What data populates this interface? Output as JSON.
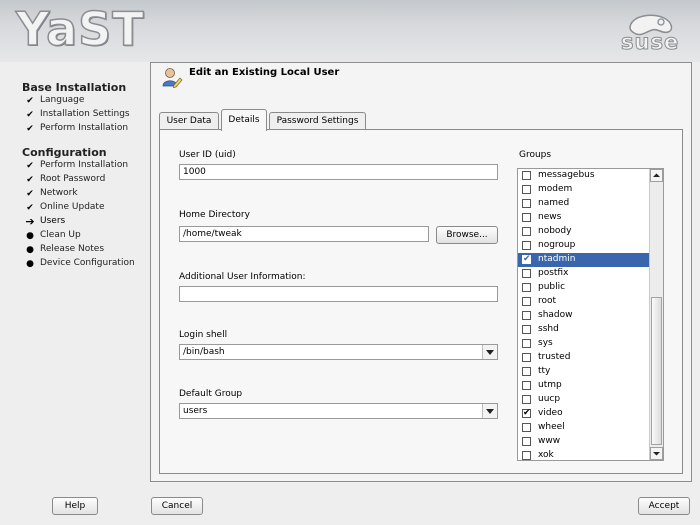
{
  "banner": {
    "app_logo": "YaST",
    "brand_logo": "suse"
  },
  "sidebar": {
    "sections": [
      {
        "title": "Base Installation",
        "steps": [
          {
            "label": "Language",
            "status": "done"
          },
          {
            "label": "Installation Settings",
            "status": "done"
          },
          {
            "label": "Perform Installation",
            "status": "done"
          }
        ]
      },
      {
        "title": "Configuration",
        "steps": [
          {
            "label": "Perform Installation",
            "status": "done"
          },
          {
            "label": "Root Password",
            "status": "done"
          },
          {
            "label": "Network",
            "status": "done"
          },
          {
            "label": "Online Update",
            "status": "done"
          },
          {
            "label": "Users",
            "status": "current"
          },
          {
            "label": "Clean Up",
            "status": "pending"
          },
          {
            "label": "Release Notes",
            "status": "pending"
          },
          {
            "label": "Device Configuration",
            "status": "pending"
          }
        ]
      }
    ]
  },
  "dialog": {
    "title": "Edit an Existing Local User",
    "tabs": [
      {
        "label": "User Data",
        "active": false
      },
      {
        "label": "Details",
        "active": true
      },
      {
        "label": "Password Settings",
        "active": false
      }
    ]
  },
  "details": {
    "uid_label": "User ID (uid)",
    "uid_value": "1000",
    "home_label": "Home Directory",
    "home_value": "/home/tweak",
    "browse_label": "Browse...",
    "info_label": "Additional User Information:",
    "info_value": "",
    "shell_label": "Login shell",
    "shell_value": "/bin/bash",
    "group_label": "Default Group",
    "group_value": "users",
    "groups_label": "Groups",
    "groups": [
      {
        "name": "messagebus",
        "checked": false
      },
      {
        "name": "modem",
        "checked": false
      },
      {
        "name": "named",
        "checked": false
      },
      {
        "name": "news",
        "checked": false
      },
      {
        "name": "nobody",
        "checked": false
      },
      {
        "name": "nogroup",
        "checked": false
      },
      {
        "name": "ntadmin",
        "checked": true,
        "selected": true
      },
      {
        "name": "postfix",
        "checked": false
      },
      {
        "name": "public",
        "checked": false
      },
      {
        "name": "root",
        "checked": false
      },
      {
        "name": "shadow",
        "checked": false
      },
      {
        "name": "sshd",
        "checked": false
      },
      {
        "name": "sys",
        "checked": false
      },
      {
        "name": "trusted",
        "checked": false
      },
      {
        "name": "tty",
        "checked": false
      },
      {
        "name": "utmp",
        "checked": false
      },
      {
        "name": "uucp",
        "checked": false
      },
      {
        "name": "video",
        "checked": true
      },
      {
        "name": "wheel",
        "checked": false
      },
      {
        "name": "www",
        "checked": false
      },
      {
        "name": "xok",
        "checked": false
      }
    ]
  },
  "footer": {
    "help_label": "Help",
    "cancel_label": "Cancel",
    "accept_label": "Accept"
  },
  "colors": {
    "selection": "#3a66ad",
    "banner": "#d7d9dc"
  }
}
